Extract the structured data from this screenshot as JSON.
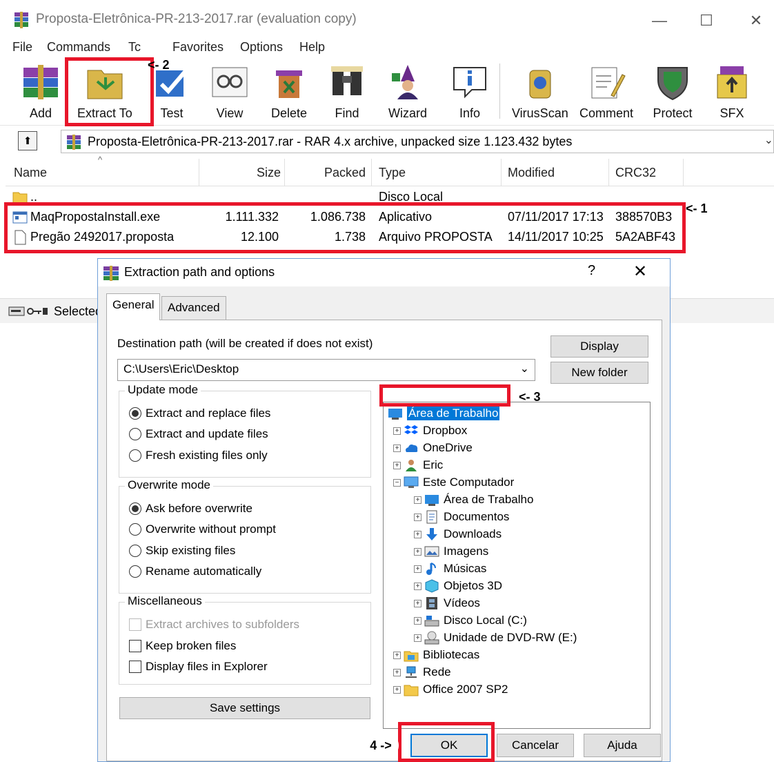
{
  "window": {
    "title": "Proposta-Eletrônica-PR-213-2017.rar (evaluation copy)",
    "minimize_glyph": "—",
    "maximize_glyph": "☐",
    "close_glyph": "✕"
  },
  "menu": [
    "File",
    "Commands",
    "Tc",
    "Favorites",
    "Options",
    "Help"
  ],
  "toolbar": {
    "buttons": [
      "Add",
      "Extract To",
      "Test",
      "View",
      "Delete",
      "Find",
      "Wizard",
      "Info",
      "VirusScan",
      "Comment",
      "Protect",
      "SFX"
    ]
  },
  "address": {
    "path": "Proposta-Eletrônica-PR-213-2017.rar - RAR 4.x archive, unpacked size 1.123.432 bytes",
    "up_glyph": "⬆",
    "dropdown_glyph": "⌄"
  },
  "filelist": {
    "columns": [
      "Name",
      "Size",
      "Packed",
      "Type",
      "Modified",
      "CRC32"
    ],
    "sort_glyph": "^",
    "rows": [
      {
        "name": "..",
        "size": "",
        "packed": "",
        "type": "Disco Local",
        "modified": "",
        "crc": ""
      },
      {
        "name": "MaqPropostaInstall.exe",
        "size": "1.111.332",
        "packed": "1.086.738",
        "type": "Aplicativo",
        "modified": "07/11/2017 17:13",
        "crc": "388570B3"
      },
      {
        "name": "Pregão 2492017.proposta",
        "size": "12.100",
        "packed": "1.738",
        "type": "Arquivo PROPOSTA",
        "modified": "14/11/2017 10:25",
        "crc": "5A2ABF43"
      }
    ]
  },
  "status": {
    "text": "Selected"
  },
  "annotations": {
    "a1": "<- 1",
    "a2": "<- 2",
    "a3": "<- 3",
    "a4": "4 ->"
  },
  "dialog": {
    "title": "Extraction path and options",
    "help_glyph": "?",
    "close_glyph": "✕",
    "tabs": [
      "General",
      "Advanced"
    ],
    "destination_label": "Destination path (will be created if does not exist)",
    "destination_value": "C:\\Users\\Eric\\Desktop",
    "combo_glyph": "⌄",
    "display_button": "Display",
    "new_folder_button": "New folder",
    "update_mode": {
      "title": "Update mode",
      "options": [
        "Extract and replace files",
        "Extract and update files",
        "Fresh existing files only"
      ],
      "selected": 0
    },
    "overwrite_mode": {
      "title": "Overwrite mode",
      "options": [
        "Ask before overwrite",
        "Overwrite without prompt",
        "Skip existing files",
        "Rename automatically"
      ],
      "selected": 0
    },
    "misc": {
      "title": "Miscellaneous",
      "options": [
        "Extract archives to subfolders",
        "Keep broken files",
        "Display files in Explorer"
      ]
    },
    "save_settings": "Save settings",
    "tree": [
      "Área de Trabalho",
      "Dropbox",
      "OneDrive",
      "Eric",
      "Este Computador",
      "Área de Trabalho",
      "Documentos",
      "Downloads",
      "Imagens",
      "Músicas",
      "Objetos 3D",
      "Vídeos",
      "Disco Local (C:)",
      "Unidade de DVD-RW (E:)",
      "Bibliotecas",
      "Rede",
      "Office 2007 SP2"
    ],
    "tree_expand_plus": "+",
    "tree_expand_minus": "−",
    "ok": "OK",
    "cancel": "Cancelar",
    "help": "Ajuda"
  },
  "colors": {
    "annotation_red": "#e8162a",
    "selection_blue": "#0078d7",
    "dialog_border": "#6f9fd8"
  }
}
